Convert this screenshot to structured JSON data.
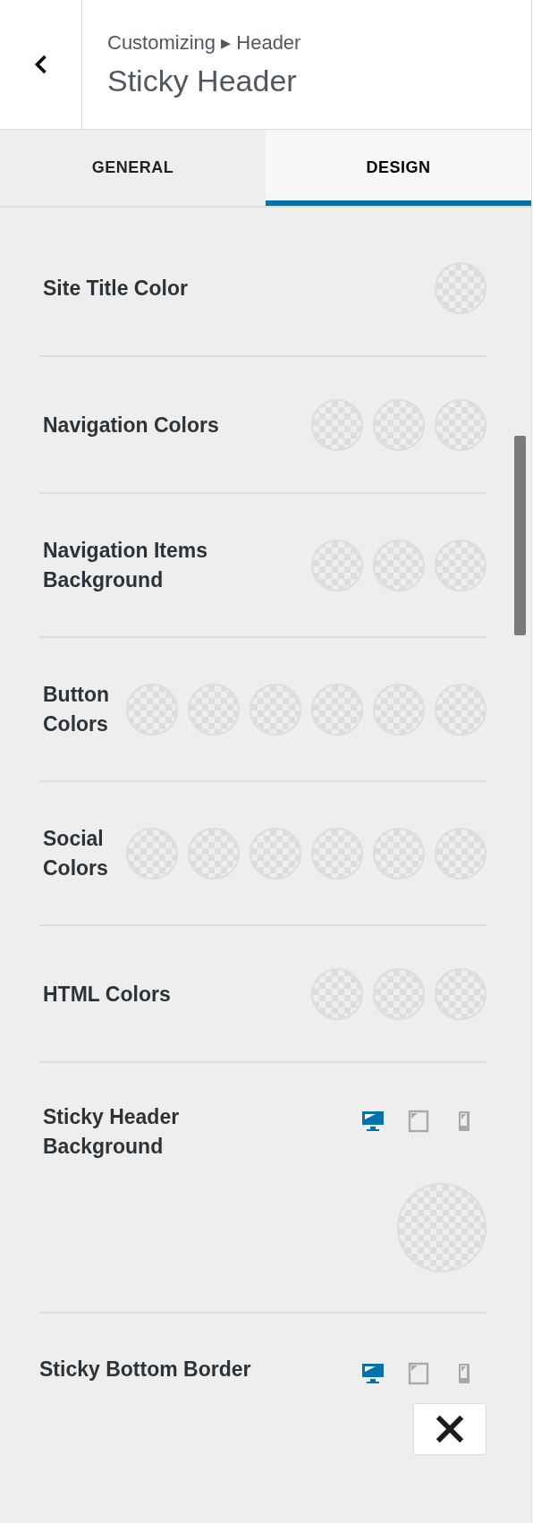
{
  "header": {
    "breadcrumb": "Customizing ▸ Header",
    "title": "Sticky Header"
  },
  "tabs": [
    {
      "label": "GENERAL",
      "selected": false
    },
    {
      "label": "DESIGN",
      "selected": true
    }
  ],
  "settings": [
    {
      "kind": "colors",
      "label": "Site Title Color",
      "swatches": [
        {
          "kind": "transparent"
        }
      ]
    },
    {
      "kind": "colors",
      "label": "Navigation Colors",
      "swatches": [
        {
          "kind": "transparent"
        },
        {
          "kind": "transparent"
        },
        {
          "kind": "transparent"
        }
      ]
    },
    {
      "kind": "colors",
      "label": "Navigation Items Background",
      "swatches": [
        {
          "kind": "transparent"
        },
        {
          "kind": "transparent"
        },
        {
          "kind": "transparent"
        }
      ]
    },
    {
      "kind": "colors",
      "label": "Button Colors",
      "swatches": [
        {
          "kind": "transparent"
        },
        {
          "kind": "transparent"
        },
        {
          "kind": "transparent"
        },
        {
          "kind": "transparent"
        },
        {
          "kind": "transparent"
        },
        {
          "kind": "transparent"
        }
      ]
    },
    {
      "kind": "colors",
      "label": "Social Colors",
      "swatches": [
        {
          "kind": "transparent"
        },
        {
          "kind": "transparent"
        },
        {
          "kind": "transparent"
        },
        {
          "kind": "transparent"
        },
        {
          "kind": "transparent"
        },
        {
          "kind": "transparent"
        }
      ]
    },
    {
      "kind": "colors",
      "label": "HTML Colors",
      "swatches": [
        {
          "kind": "transparent"
        },
        {
          "kind": "transparent"
        },
        {
          "kind": "transparent"
        }
      ]
    },
    {
      "kind": "background",
      "label": "Sticky Header Background",
      "devices": [
        {
          "kind": "desktop",
          "selected": true
        },
        {
          "kind": "tablet",
          "selected": false
        },
        {
          "kind": "mobile",
          "selected": false
        }
      ],
      "swatches": [
        {
          "kind": "transparent"
        }
      ]
    },
    {
      "kind": "border",
      "label": "Sticky Bottom Border",
      "devices": [
        {
          "kind": "desktop",
          "selected": true
        },
        {
          "kind": "tablet",
          "selected": false
        },
        {
          "kind": "mobile",
          "selected": false
        }
      ]
    }
  ]
}
